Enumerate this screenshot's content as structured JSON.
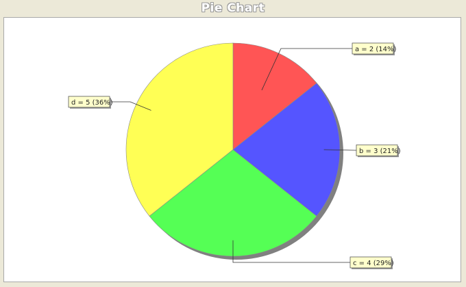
{
  "chart_data": {
    "type": "pie",
    "title": "Pie Chart",
    "slices": [
      {
        "label": "a",
        "value": 2,
        "percent_label": "14%",
        "color": "#ff5555"
      },
      {
        "label": "b",
        "value": 3,
        "percent_label": "21%",
        "color": "#5555ff"
      },
      {
        "label": "c",
        "value": 4,
        "percent_label": "29%",
        "color": "#55ff55"
      },
      {
        "label": "d",
        "value": 5,
        "percent_label": "36%",
        "color": "#ffff55"
      }
    ],
    "start_angle": "12 o'clock",
    "direction": "clockwise",
    "label_box_color": "#ffffcc",
    "shadow": true
  }
}
